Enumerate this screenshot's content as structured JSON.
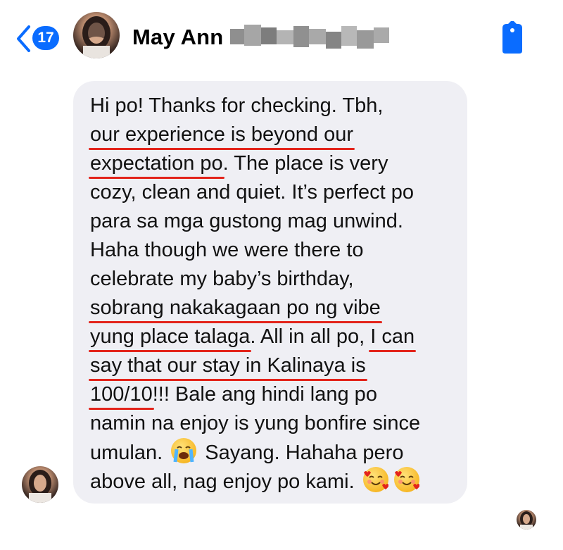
{
  "header": {
    "back_count": "17",
    "contact_name": "May Ann"
  },
  "message": {
    "lines": [
      [
        {
          "t": "Hi po! Thanks for checking. Tbh,"
        }
      ],
      [
        {
          "t": "our experience is beyond our",
          "u": true
        }
      ],
      [
        {
          "t": "expectation po",
          "u": true
        },
        {
          "t": ". The place is very"
        }
      ],
      [
        {
          "t": "cozy, clean and quiet. It’s perfect po"
        }
      ],
      [
        {
          "t": "para sa mga gustong mag unwind."
        }
      ],
      [
        {
          "t": "Haha though we were there to"
        }
      ],
      [
        {
          "t": "celebrate my baby’s birthday,"
        }
      ],
      [
        {
          "t": "sobrang nakakagaan po ng vibe",
          "u": true
        }
      ],
      [
        {
          "t": "yung place talaga",
          "u": true
        },
        {
          "t": ". All in all po, "
        },
        {
          "t": "I can",
          "u": true
        }
      ],
      [
        {
          "t": "say that our stay in Kalinaya is",
          "u": true
        }
      ],
      [
        {
          "t": "100/10",
          "u": true
        },
        {
          "t": "!!! Bale ang hindi lang po"
        }
      ],
      [
        {
          "t": "namin na enjoy is yung bonfire since"
        }
      ],
      [
        {
          "t": "umulan. "
        },
        {
          "emoji": "loudly-crying-face"
        },
        {
          "t": " Sayang. Hahaha pero"
        }
      ],
      [
        {
          "t": "above all, nag enjoy po kami. "
        },
        {
          "emoji": "smiling-face-with-hearts"
        },
        {
          "emoji": "smiling-face-with-hearts"
        }
      ]
    ]
  },
  "colors": {
    "accent": "#0a6cff",
    "bubble": "#efeff4",
    "underline": "#e3241b"
  }
}
